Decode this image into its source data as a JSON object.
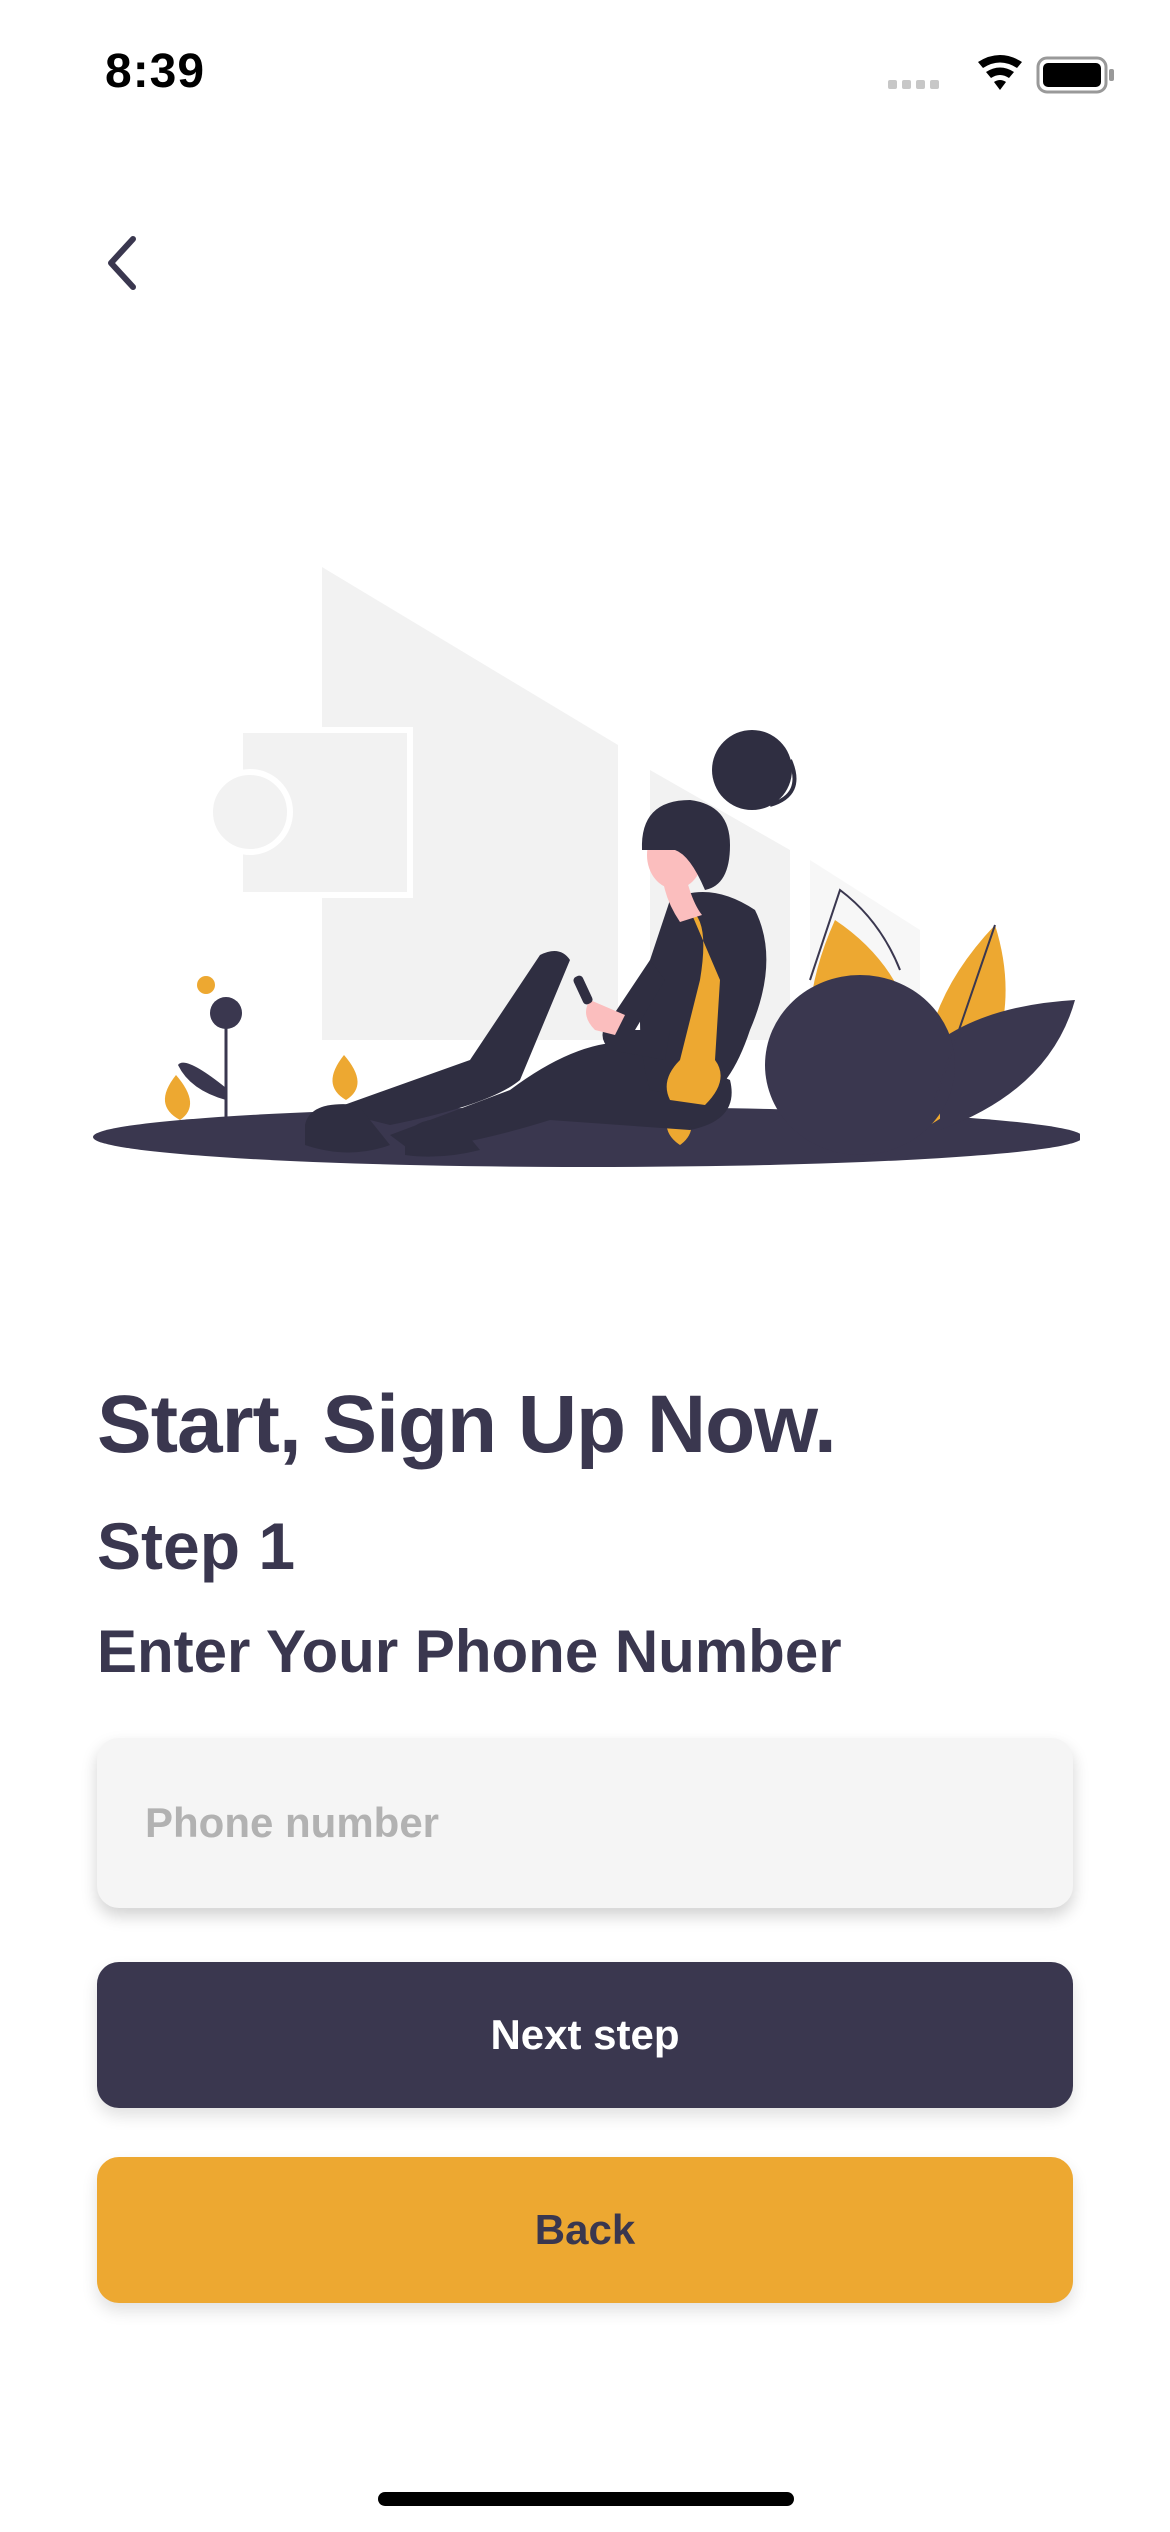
{
  "status_bar": {
    "time": "8:39"
  },
  "nav": {
    "back_icon": "chevron-left-icon"
  },
  "illustration": {
    "description_icon": "woman-sitting-with-phone-illustration",
    "colors": {
      "dark": "#3a374f",
      "accent": "#eda831",
      "light_gray": "#f2f2f2",
      "skin": "#fbbebe"
    }
  },
  "content": {
    "headline": "Start, Sign Up Now.",
    "step": "Step 1",
    "instruction": "Enter Your Phone Number"
  },
  "form": {
    "phone_placeholder": "Phone number",
    "phone_value": ""
  },
  "actions": {
    "next_label": "Next step",
    "back_label": "Back"
  },
  "theme": {
    "primary": "#3a374f",
    "accent": "#eda831",
    "input_bg": "#f5f5f5",
    "placeholder": "#b2b2b2"
  }
}
